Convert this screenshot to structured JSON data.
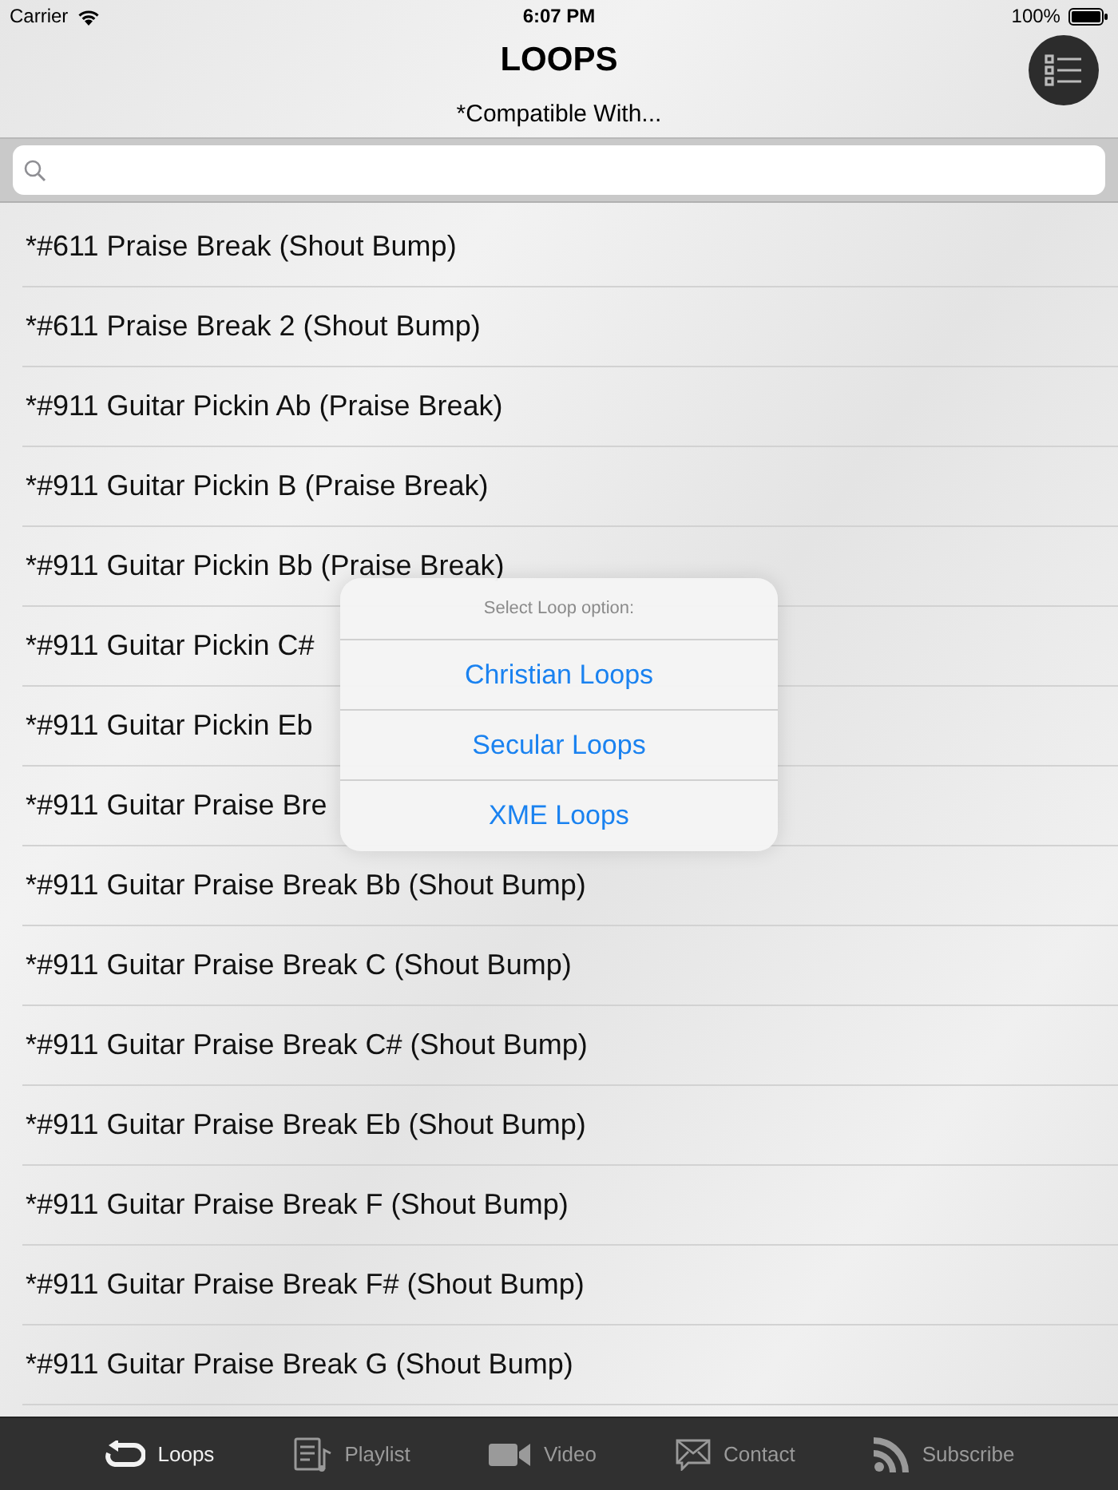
{
  "status_bar": {
    "carrier": "Carrier",
    "time": "6:07 PM",
    "battery": "100%"
  },
  "header": {
    "title": "LOOPS",
    "subtitle": "*Compatible With..."
  },
  "rows": [
    {
      "label": "*#611 Praise Break (Shout Bump)"
    },
    {
      "label": "*#611 Praise Break 2 (Shout Bump)"
    },
    {
      "label": "*#911 Guitar Pickin Ab (Praise Break)"
    },
    {
      "label": "*#911 Guitar Pickin B (Praise Break)"
    },
    {
      "label": "*#911 Guitar Pickin Bb (Praise Break)"
    },
    {
      "label": "*#911 Guitar Pickin C#"
    },
    {
      "label": "*#911 Guitar Pickin Eb"
    },
    {
      "label": "*#911 Guitar Praise Bre"
    },
    {
      "label": "*#911 Guitar Praise Break Bb (Shout Bump)"
    },
    {
      "label": "*#911 Guitar Praise Break C (Shout Bump)"
    },
    {
      "label": "*#911 Guitar Praise Break C# (Shout Bump)"
    },
    {
      "label": "*#911 Guitar Praise Break Eb (Shout Bump)"
    },
    {
      "label": "*#911 Guitar Praise Break F (Shout Bump)"
    },
    {
      "label": "*#911 Guitar Praise Break F# (Shout Bump)"
    },
    {
      "label": "*#911 Guitar Praise Break G (Shout Bump)"
    }
  ],
  "action_sheet": {
    "title": "Select Loop option:",
    "options": [
      "Christian Loops",
      "Secular Loops",
      "XME Loops"
    ]
  },
  "tabs": [
    {
      "kind": "loop",
      "label": "Loops",
      "selected": true
    },
    {
      "kind": "playlist",
      "label": "Playlist",
      "selected": false
    },
    {
      "kind": "video",
      "label": "Video",
      "selected": false
    },
    {
      "kind": "mail",
      "label": "Contact",
      "selected": false
    },
    {
      "kind": "rss",
      "label": "Subscribe",
      "selected": false
    }
  ]
}
